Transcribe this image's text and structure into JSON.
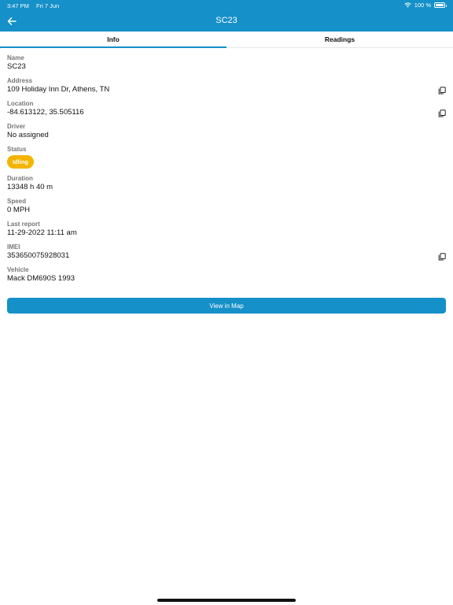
{
  "status_bar": {
    "time": "3:47 PM",
    "date": "Fri 7 Jun",
    "battery": "100 %"
  },
  "header": {
    "title": "SC23"
  },
  "tabs": [
    {
      "label": "Info"
    },
    {
      "label": "Readings"
    }
  ],
  "fields": {
    "name": {
      "label": "Name",
      "value": "SC23"
    },
    "address": {
      "label": "Address",
      "value": "109 Holiday Inn Dr, Athens, TN"
    },
    "location": {
      "label": "Location",
      "value": "-84.613122, 35.505116"
    },
    "driver": {
      "label": "Driver",
      "value": "No assigned"
    },
    "status": {
      "label": "Status",
      "value": "Idling",
      "color": "#f4b400"
    },
    "duration": {
      "label": "Duration",
      "value": "13348 h 40 m"
    },
    "speed": {
      "label": "Speed",
      "value": "0 MPH"
    },
    "last_report": {
      "label": "Last report",
      "value": "11-29-2022 11:11 am"
    },
    "imei": {
      "label": "IMEI",
      "value": "353650075928031"
    },
    "vehicle": {
      "label": "Vehicle",
      "value": "Mack DM690S 1993"
    }
  },
  "actions": {
    "view_map": "View in Map"
  },
  "colors": {
    "accent": "#1590c8",
    "status_idling": "#f4b400"
  },
  "icons": {
    "back": "arrow-left-icon",
    "copy": "copy-icon",
    "wifi": "wifi-icon",
    "battery": "battery-icon"
  }
}
